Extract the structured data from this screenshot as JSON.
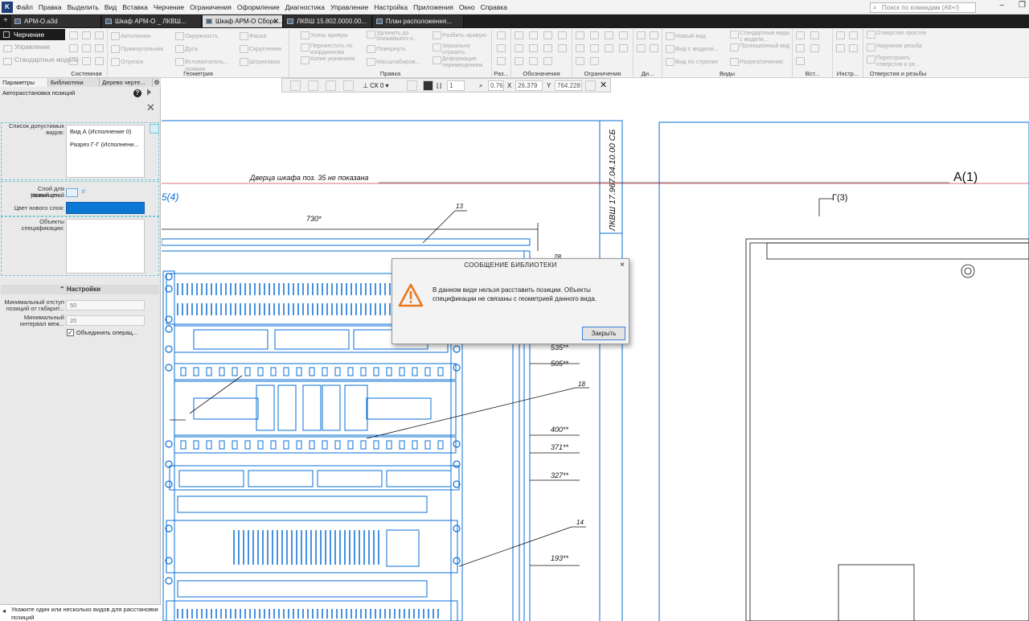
{
  "app": {
    "logo": "K",
    "menu": [
      "Файл",
      "Правка",
      "Выделить",
      "Вид",
      "Вставка",
      "Черчение",
      "Ограничения",
      "Оформление",
      "Диагностика",
      "Управление",
      "Настройка",
      "Приложения",
      "Окно",
      "Справка"
    ],
    "search_placeholder": "Поиск по командам (Alt+/)"
  },
  "tabs": [
    {
      "label": "АРМ-О.a3d",
      "active": false
    },
    {
      "label": "Шкаф АРМ-О _ ЛКВШ...",
      "active": false
    },
    {
      "label": "Шкаф АРМ-О Сборо...",
      "active": true
    },
    {
      "label": "ЛКВШ 15.802.0000.00...",
      "active": false
    },
    {
      "label": "План расположения...",
      "active": false
    }
  ],
  "ribbon": {
    "active_tab": "Черчение",
    "left_items": [
      "Управление",
      "Стандартные модели"
    ],
    "groups": [
      {
        "label": "Системная"
      },
      {
        "label": "Геометрия",
        "items": [
          "Автолиния",
          "Окружность",
          "Фаска",
          "Прямоугольник",
          "Дуга",
          "Скругление",
          "Отрезок",
          "Вспомогатель... прямая",
          "Штриховка"
        ]
      },
      {
        "label": "Правка",
        "items": [
          "Усечь кривую",
          "Удлинить до ближайшего о...",
          "Разбить кривую",
          "Переместить по координатам",
          "Повернуть",
          "Зеркально отразить",
          "Копия указанием",
          "Масштабиров...",
          "Деформация перемещением"
        ]
      },
      {
        "label": "Раз..."
      },
      {
        "label": "Обозначения"
      },
      {
        "label": "Ограничения"
      },
      {
        "label": "Ди..."
      },
      {
        "label": "Виды",
        "items": [
          "Новый вид",
          "Стандартные виды с модели...",
          "Вид с модели...",
          "Проекционный вид",
          "Вид по стрелке",
          "Разрез/сечение"
        ]
      },
      {
        "label": "Вст..."
      },
      {
        "label": "Инстр..."
      },
      {
        "label": "Отверстия и резьбы",
        "items": [
          "Отверстие простое",
          "Наружная резьба",
          "Перестроить отверстия и ре..."
        ]
      }
    ]
  },
  "left_panel": {
    "tabs": [
      "Параметры",
      "Библиотеки",
      "Дерево черте..."
    ],
    "title": "Авторасстановка позиций",
    "help_icon": "?",
    "close_icon": "✕",
    "list_label": "Список допустимых видов:",
    "views": [
      "Вид А (Исполнение 0)",
      "Разрез Г-Г (Исполнени..."
    ],
    "layer_label": "Слой для размещен...",
    "layer_sub": "Новый слой",
    "color_label": "Цвет нового слоя:",
    "layer_color": "#0a78d4",
    "objects_label": "Объекты спецификации:",
    "settings_header": "Настройки",
    "settings_chevron": "⌃",
    "min_offset_label": "Минимальный отступ позиций от габарит...",
    "min_offset_value": "50",
    "min_interval_label": "Минимальный интервал меж...",
    "min_interval_value": "20",
    "combine_label": "Объединять операц...",
    "combine_checked": true,
    "combine_mark": "✓",
    "status_text": "Укажите один или несколько видов для расстановки позиций"
  },
  "float_toolbar": {
    "cs": "СК 0",
    "step": "1",
    "zoom": "0.764",
    "x_label": "X",
    "x_value": "26.379",
    "y_label": "Y",
    "y_value": "764.228"
  },
  "drawing": {
    "door_note": "Дверца шкафа поз. 35 не показана",
    "door_pos": "35",
    "stamp": "ЛКВШ 17.967.04.10.00 СБ",
    "view_a": "А(1)",
    "section_g": "Г(3)",
    "left_mark": "5(4)",
    "dim_730": "730*",
    "dims": [
      "535**",
      "505**",
      "400**",
      "371**",
      "327**",
      "193**",
      "28"
    ],
    "leaders": [
      "13",
      "18",
      "14"
    ]
  },
  "dialog": {
    "title": "СООБЩЕНИЕ БИБЛИОТЕКИ",
    "message": "В данном виде нельзя расставить позиции. Объекты спецификации не связаны с геометрией данного вида.",
    "button": "Закрыть",
    "close": "×",
    "icon": "warning-icon",
    "icon_color": "#e8791e"
  }
}
